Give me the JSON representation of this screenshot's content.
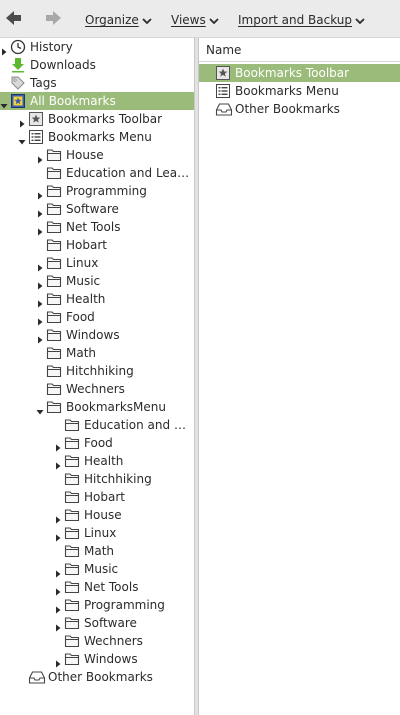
{
  "toolbar": {
    "back_icon": "back-arrow-icon",
    "forward_icon": "forward-arrow-icon",
    "organize_label": "Organize",
    "views_label": "Views",
    "import_label": "Import and Backup"
  },
  "sidebar": {
    "rows": [
      {
        "label": "History",
        "icon": "history-clock-icon",
        "depth": 0,
        "twisty": "collapsed",
        "selected": false
      },
      {
        "label": "Downloads",
        "icon": "download-arrow-icon",
        "depth": 0,
        "twisty": "none",
        "selected": false
      },
      {
        "label": "Tags",
        "icon": "tag-icon",
        "depth": 0,
        "twisty": "none",
        "selected": false
      },
      {
        "label": "All Bookmarks",
        "icon": "all-bookmarks-icon",
        "depth": 0,
        "twisty": "expanded",
        "selected": true
      },
      {
        "label": "Bookmarks Toolbar",
        "icon": "bookmarks-toolbar-icon",
        "depth": 1,
        "twisty": "collapsed",
        "selected": false
      },
      {
        "label": "Bookmarks Menu",
        "icon": "bookmarks-menu-icon",
        "depth": 1,
        "twisty": "expanded",
        "selected": false
      },
      {
        "label": "House",
        "icon": "folder-icon",
        "depth": 2,
        "twisty": "collapsed",
        "selected": false
      },
      {
        "label": "Education and Learni…",
        "icon": "folder-icon",
        "depth": 2,
        "twisty": "none",
        "selected": false
      },
      {
        "label": "Programming",
        "icon": "folder-icon",
        "depth": 2,
        "twisty": "collapsed",
        "selected": false
      },
      {
        "label": "Software",
        "icon": "folder-icon",
        "depth": 2,
        "twisty": "collapsed",
        "selected": false
      },
      {
        "label": "Net Tools",
        "icon": "folder-icon",
        "depth": 2,
        "twisty": "collapsed",
        "selected": false
      },
      {
        "label": "Hobart",
        "icon": "folder-icon",
        "depth": 2,
        "twisty": "none",
        "selected": false
      },
      {
        "label": "Linux",
        "icon": "folder-icon",
        "depth": 2,
        "twisty": "collapsed",
        "selected": false
      },
      {
        "label": "Music",
        "icon": "folder-icon",
        "depth": 2,
        "twisty": "collapsed",
        "selected": false
      },
      {
        "label": "Health",
        "icon": "folder-icon",
        "depth": 2,
        "twisty": "collapsed",
        "selected": false
      },
      {
        "label": "Food",
        "icon": "folder-icon",
        "depth": 2,
        "twisty": "collapsed",
        "selected": false
      },
      {
        "label": "Windows",
        "icon": "folder-icon",
        "depth": 2,
        "twisty": "collapsed",
        "selected": false
      },
      {
        "label": "Math",
        "icon": "folder-icon",
        "depth": 2,
        "twisty": "none",
        "selected": false
      },
      {
        "label": "Hitchhiking",
        "icon": "folder-icon",
        "depth": 2,
        "twisty": "none",
        "selected": false
      },
      {
        "label": "Wechners",
        "icon": "folder-icon",
        "depth": 2,
        "twisty": "none",
        "selected": false
      },
      {
        "label": "BookmarksMenu",
        "icon": "folder-icon",
        "depth": 2,
        "twisty": "expanded",
        "selected": false
      },
      {
        "label": "Education and Lea…",
        "icon": "folder-icon",
        "depth": 3,
        "twisty": "none",
        "selected": false
      },
      {
        "label": "Food",
        "icon": "folder-icon",
        "depth": 3,
        "twisty": "collapsed",
        "selected": false
      },
      {
        "label": "Health",
        "icon": "folder-icon",
        "depth": 3,
        "twisty": "collapsed",
        "selected": false
      },
      {
        "label": "Hitchhiking",
        "icon": "folder-icon",
        "depth": 3,
        "twisty": "none",
        "selected": false
      },
      {
        "label": "Hobart",
        "icon": "folder-icon",
        "depth": 3,
        "twisty": "none",
        "selected": false
      },
      {
        "label": "House",
        "icon": "folder-icon",
        "depth": 3,
        "twisty": "collapsed",
        "selected": false
      },
      {
        "label": "Linux",
        "icon": "folder-icon",
        "depth": 3,
        "twisty": "collapsed",
        "selected": false
      },
      {
        "label": "Math",
        "icon": "folder-icon",
        "depth": 3,
        "twisty": "none",
        "selected": false
      },
      {
        "label": "Music",
        "icon": "folder-icon",
        "depth": 3,
        "twisty": "collapsed",
        "selected": false
      },
      {
        "label": "Net Tools",
        "icon": "folder-icon",
        "depth": 3,
        "twisty": "collapsed",
        "selected": false
      },
      {
        "label": "Programming",
        "icon": "folder-icon",
        "depth": 3,
        "twisty": "collapsed",
        "selected": false
      },
      {
        "label": "Software",
        "icon": "folder-icon",
        "depth": 3,
        "twisty": "collapsed",
        "selected": false
      },
      {
        "label": "Wechners",
        "icon": "folder-icon",
        "depth": 3,
        "twisty": "none",
        "selected": false
      },
      {
        "label": "Windows",
        "icon": "folder-icon",
        "depth": 3,
        "twisty": "collapsed",
        "selected": false
      },
      {
        "label": "Other Bookmarks",
        "icon": "other-bookmarks-icon",
        "depth": 1,
        "twisty": "none",
        "selected": false
      }
    ]
  },
  "content": {
    "column_name": "Name",
    "rows": [
      {
        "label": "Bookmarks Toolbar",
        "icon": "bookmarks-toolbar-icon",
        "selected": true
      },
      {
        "label": "Bookmarks Menu",
        "icon": "bookmarks-menu-icon",
        "selected": false
      },
      {
        "label": "Other Bookmarks",
        "icon": "other-bookmarks-icon",
        "selected": false
      }
    ]
  },
  "colors": {
    "selection": "#9bbb7a",
    "folder_stroke": "#444444",
    "downloads_green": "#5cb82e"
  }
}
